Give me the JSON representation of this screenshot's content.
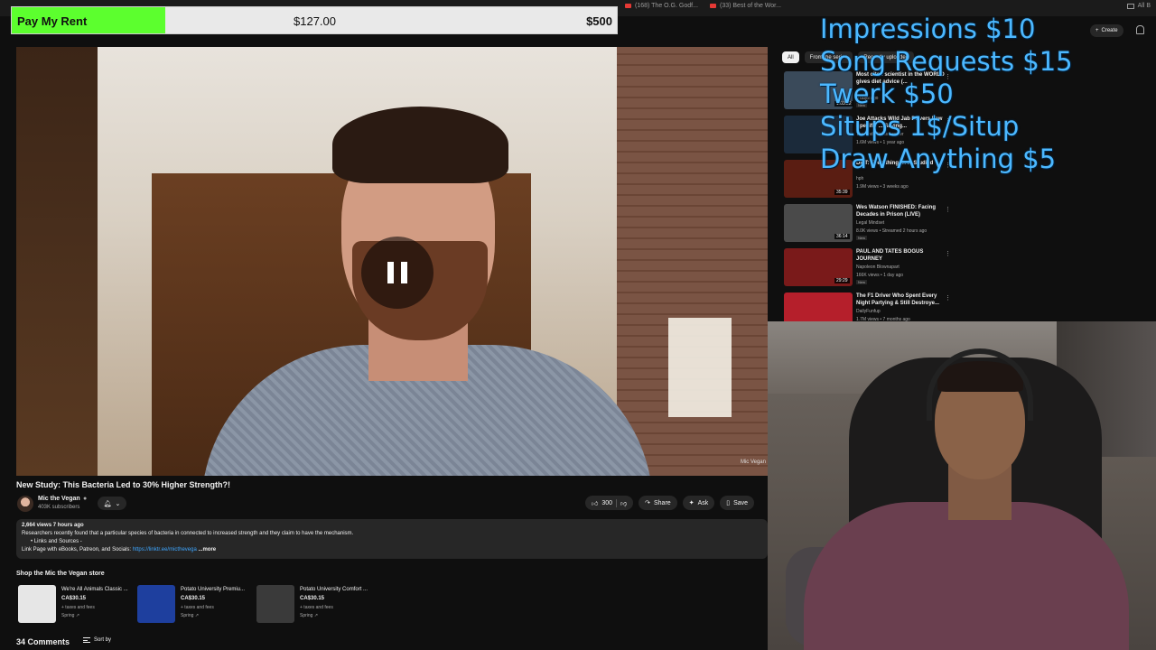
{
  "browser": {
    "tabs": [
      "(168) The O.G. Godf...",
      "(33) Best of the Wor..."
    ],
    "bookmarks_label": "All B"
  },
  "goal": {
    "label": "Pay My Rent",
    "current": "$127.00",
    "target": "$500",
    "progress_fraction": 0.254,
    "fill_color": "#5cff2e"
  },
  "price_menu": [
    "Impressions $10",
    "Song Requests $15",
    "Twerk $50",
    "Situps 1$/Situp",
    "Draw Anything $5"
  ],
  "player": {
    "state": "paused",
    "control_icon": "pause-icon",
    "watermark": "Mic Vegan"
  },
  "video": {
    "title": "New Study: This Bacteria Led to 30% Higher Strength?!",
    "channel": "Mic the Vegan",
    "subscribers": "403K subscribers",
    "bell_icon": "bell-icon",
    "likes": "300",
    "share_label": "Share",
    "ask_label": "Ask",
    "save_label": "Save"
  },
  "description": {
    "stats": "2,664 views  7 hours ago",
    "line1": "Researchers recently found that a particular species of bacteria in connected to increased strength and they claim to have the mechanism.",
    "line2": "•  Links and Sources -",
    "line3_prefix": "Link Page with eBooks, Patreon, and Socials: ",
    "link": "https://linktr.ee/micthevega",
    "more": "...more"
  },
  "store": {
    "title": "Shop the Mic the Vegan store",
    "products": [
      {
        "name": "We're All Animals Classic ...",
        "price": "CA$30.15",
        "fees": "+ taxes and fees",
        "vendor": "Spring ↗",
        "thumb_color": "#e6e6e6"
      },
      {
        "name": "Potato University Premiu...",
        "price": "CA$30.15",
        "fees": "+ taxes and fees",
        "vendor": "Spring ↗",
        "thumb_color": "#1e3f9e"
      },
      {
        "name": "Potato University Comfort ...",
        "price": "CA$30.15",
        "fees": "+ taxes and fees",
        "vendor": "Spring ↗",
        "thumb_color": "#3a3a3a"
      }
    ]
  },
  "comments": {
    "count": "34 Comments",
    "sort_label": "Sort by"
  },
  "sidebar": {
    "create_label": "Create",
    "chips": [
      "All",
      "From the series",
      "Recently uploaded"
    ],
    "recommendations": [
      {
        "title": "Most cited scientist in the WORLD gives diet advice (...",
        "channel": "",
        "meta": "3 days ago",
        "badge": "New",
        "duration": "1:03:22",
        "thumb_color": "#3a4a5a"
      },
      {
        "title": "Joe Attacks Wild Jab Drivers Law Specific ... Saying...",
        "channel": "The Civil Rights Lawyer",
        "meta": "1.6M views • 1 year ago",
        "badge": "",
        "duration": "",
        "thumb_color": "#1b2a3a"
      },
      {
        "title": "DMT: Everything Ever Studied",
        "channel": "hph",
        "meta": "1.9M views • 3 weeks ago",
        "badge": "",
        "duration": "35:39",
        "thumb_color": "#5a1d12"
      },
      {
        "title": "Wes Watson FINISHED: Facing Decades in Prison (LIVE)",
        "channel": "Legal Mindset",
        "meta": "8.0K views • Streamed 2 hours ago",
        "badge": "New",
        "duration": "36:14",
        "thumb_color": "#4a4a4a"
      },
      {
        "title": "PAUL AND TATES BOGUS JOURNEY",
        "channel": "Napoleon Blownapart",
        "meta": "166K views • 1 day ago",
        "badge": "New",
        "duration": "29:29",
        "thumb_color": "#7a1a1a"
      },
      {
        "title": "The F1 Driver Who Spent Every Night Partying & Still Destroye...",
        "channel": "DailyFunfup",
        "meta": "1.7M views • 7 months ago",
        "badge": "",
        "duration": "",
        "thumb_color": "#b51f2b"
      }
    ]
  }
}
